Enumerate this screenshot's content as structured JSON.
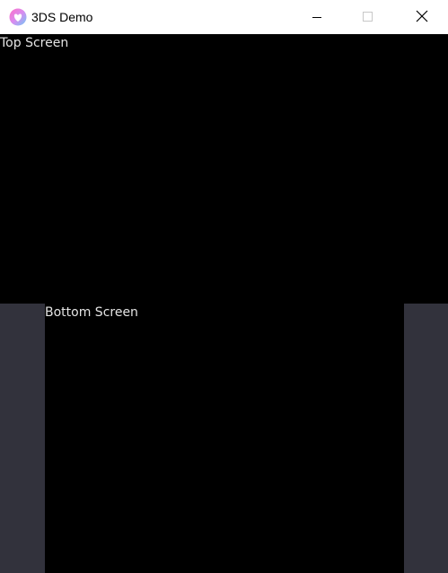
{
  "window": {
    "title": "3DS Demo",
    "icon": "heart-app-icon",
    "controls": {
      "minimize": "minimize-icon",
      "maximize": "maximize-icon",
      "close": "close-icon"
    }
  },
  "top_screen": {
    "label": "Top Screen"
  },
  "bottom_screen": {
    "label": "Bottom Screen"
  },
  "colors": {
    "background": "#32323c",
    "screen": "#000000",
    "label_text": "#e4e4e4",
    "titlebar": "#ffffff",
    "icon_gradient_start": "#f0a0d8",
    "icon_gradient_end": "#8ac8f0"
  }
}
